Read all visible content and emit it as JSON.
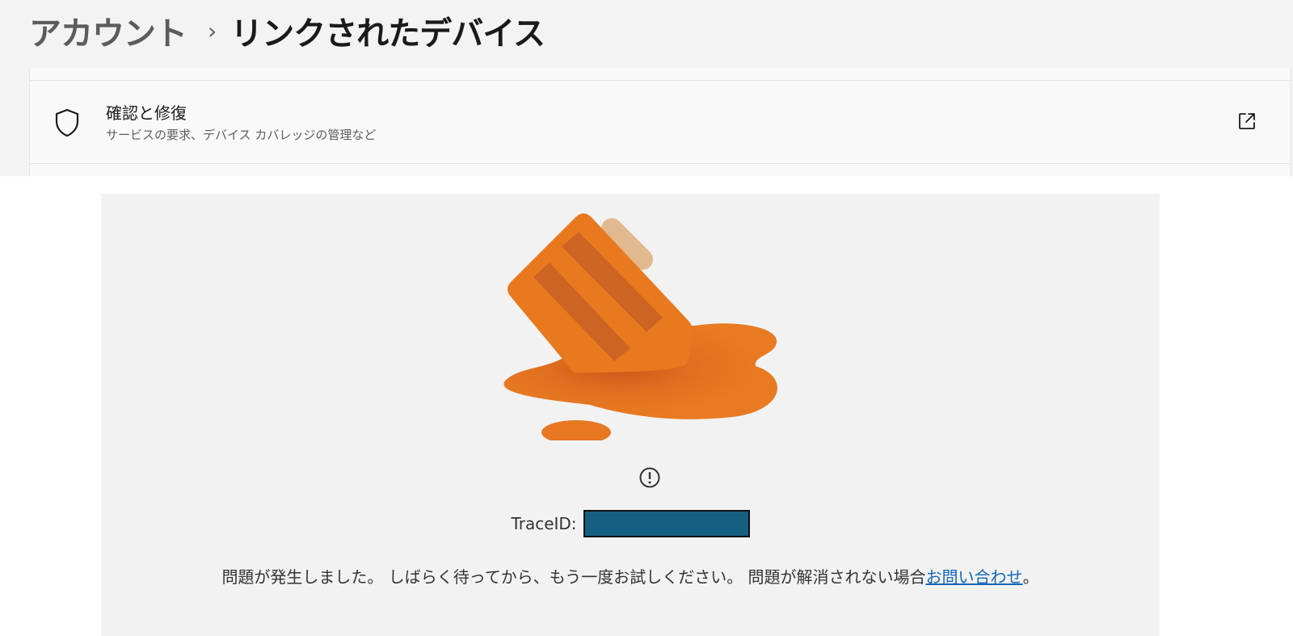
{
  "header": {
    "breadcrumb_parent": "アカウント",
    "breadcrumb_separator": "›",
    "breadcrumb_current": "リンクされたデバイス"
  },
  "settings": {
    "rows": [
      {
        "icon": "shield-icon",
        "title": "確認と修復",
        "subtitle": "サービスの要求、デバイス カバレッジの管理など",
        "action_icon": "external-link-icon"
      }
    ]
  },
  "error": {
    "illustration": "melted-popsicle-illustration",
    "status_icon": "info-circle-icon",
    "trace_label": "TraceID:",
    "trace_value": "",
    "message_prefix": "問題が発生しました。 しばらく待ってから、もう一度お試しください。 問題が解消されない場合",
    "contact_link": "お問い合わせ",
    "message_suffix": "。"
  },
  "colors": {
    "accent_orange": "#e87722",
    "link_blue": "#1467b8",
    "redaction": "#155f82"
  }
}
